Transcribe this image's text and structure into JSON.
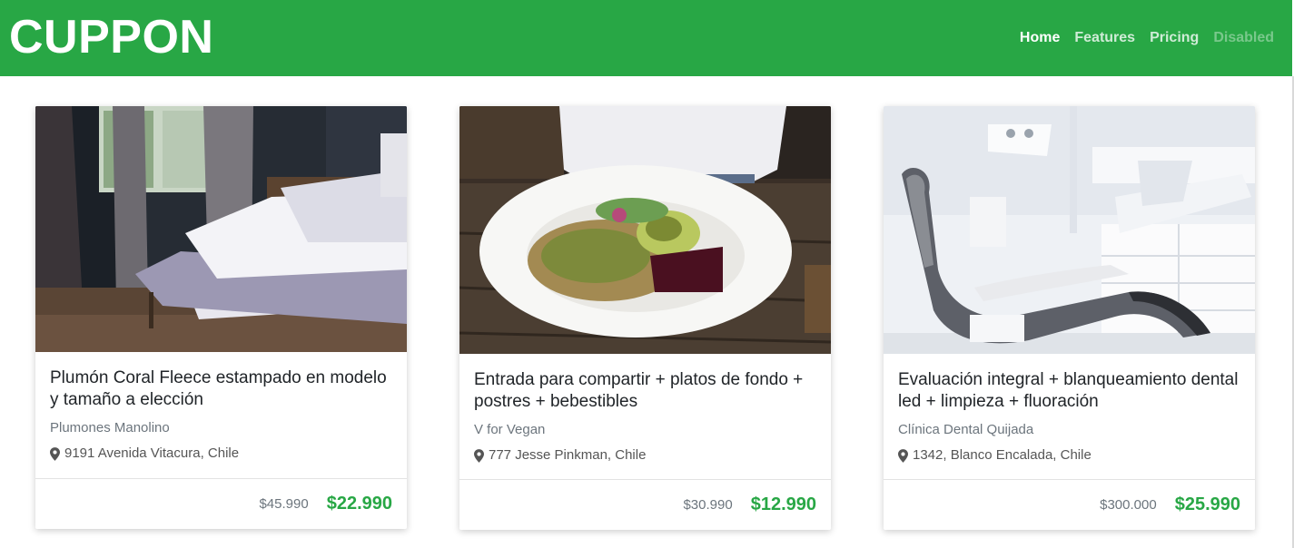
{
  "navbar": {
    "brand": "CUPPON",
    "links": [
      {
        "label": "Home",
        "state": "active"
      },
      {
        "label": "Features",
        "state": "normal"
      },
      {
        "label": "Pricing",
        "state": "normal"
      },
      {
        "label": "Disabled",
        "state": "disabled"
      }
    ],
    "color": "#28a745"
  },
  "deals": [
    {
      "image": "bedroom-photo",
      "title": "Plumón Coral Fleece estampado en modelo y tamaño a elección",
      "merchant": "Plumones Manolino",
      "address": "9191 Avenida Vitacura, Chile",
      "old_price": "$45.990",
      "new_price": "$22.990"
    },
    {
      "image": "salad-plate-photo",
      "title": "Entrada para compartir + platos de fondo + postres + bebestibles",
      "merchant": "V for Vegan",
      "address": "777 Jesse Pinkman, Chile",
      "old_price": "$30.990",
      "new_price": "$12.990"
    },
    {
      "image": "dental-chair-photo",
      "title": "Evaluación integral + blanqueamiento dental led + limpieza + fluoración",
      "merchant": "Clínica Dental Quijada",
      "address": "1342, Blanco Encalada, Chile",
      "old_price": "$300.000",
      "new_price": "$25.990"
    }
  ],
  "icons": {
    "address": "map-pin-icon"
  }
}
